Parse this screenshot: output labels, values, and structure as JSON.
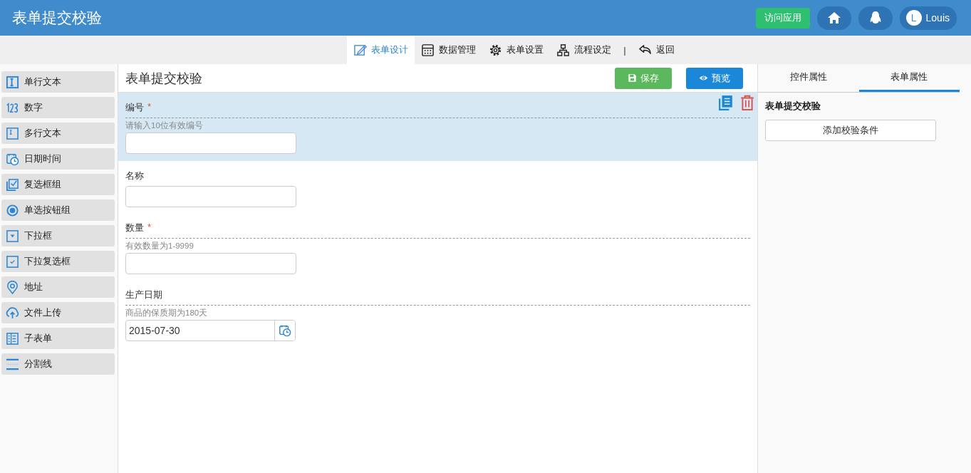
{
  "header": {
    "title": "表单提交校验",
    "visit_button": "访问应用",
    "user": {
      "initial": "L",
      "name": "Louis"
    }
  },
  "nav": {
    "tabs": [
      {
        "label": "表单设计",
        "kind": "design",
        "selected": true
      },
      {
        "label": "数据管理",
        "kind": "grid",
        "selected": false
      },
      {
        "label": "表单设置",
        "kind": "gear",
        "selected": false
      },
      {
        "label": "流程设定",
        "kind": "flow",
        "selected": false
      }
    ],
    "separator": "|",
    "back": "返回"
  },
  "palette": [
    {
      "label": "单行文本",
      "kind": "textline"
    },
    {
      "label": "数字",
      "kind": "number"
    },
    {
      "label": "多行文本",
      "kind": "textarea"
    },
    {
      "label": "日期时间",
      "kind": "calendar"
    },
    {
      "label": "复选框组",
      "kind": "checkgroup"
    },
    {
      "label": "单选按钮组",
      "kind": "radio"
    },
    {
      "label": "下拉框",
      "kind": "dropdown"
    },
    {
      "label": "下拉复选框",
      "kind": "dropcheck"
    },
    {
      "label": "地址",
      "kind": "pin"
    },
    {
      "label": "文件上传",
      "kind": "upload"
    },
    {
      "label": "子表单",
      "kind": "subform"
    },
    {
      "label": "分割线",
      "kind": "divider"
    }
  ],
  "canvas": {
    "title": "表单提交校验",
    "save_button": "保存",
    "preview_button": "预览",
    "fields": [
      {
        "kind": "text",
        "label": "编号",
        "required_mark": "*",
        "hint": "请输入10位有效编号",
        "selected": true
      },
      {
        "kind": "text",
        "label": "名称",
        "selected": false
      },
      {
        "kind": "text",
        "label": "数量",
        "required_mark": "*",
        "hint": "有效数量为1-9999",
        "selected": false
      },
      {
        "kind": "date",
        "label": "生产日期",
        "hint": "商品的保质期为180天",
        "value": "2015-07-30",
        "selected": false
      }
    ]
  },
  "properties": {
    "tabs": [
      {
        "label": "控件属性",
        "selected": false
      },
      {
        "label": "表单属性",
        "selected": true
      }
    ],
    "form_name": "表单提交校验",
    "add_button": "添加校验条件"
  }
}
